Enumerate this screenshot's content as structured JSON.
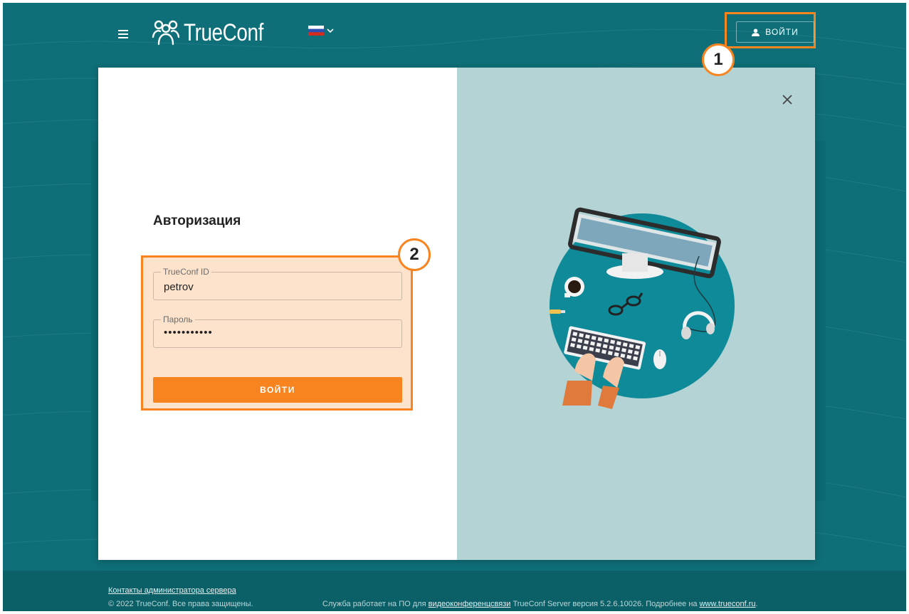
{
  "header": {
    "logo_text": "TrueConf",
    "login_label": "ВОЙТИ"
  },
  "callouts": {
    "one": "1",
    "two": "2"
  },
  "login_form": {
    "title": "Авторизация",
    "id_label": "TrueConf ID",
    "id_value": "petrov",
    "password_label": "Пароль",
    "password_value": "•••••••••••",
    "submit_label": "ВОЙТИ"
  },
  "footer": {
    "contacts_link": "Контакты администратора сервера",
    "copyright": "© 2022 TrueConf. Все права защищены.",
    "service_prefix": "Служба работает на ПО для ",
    "service_link": "видеоконференцсвязи",
    "service_middle": " TrueConf Server версия 5.2.6.10026. Подробнее на ",
    "site_link": "www.trueconf.ru",
    "service_suffix": "."
  },
  "colors": {
    "background": "#0e6f78",
    "accent": "#f7841f",
    "highlight_fill": "#fde3cc",
    "modal_right": "#b3d3d4",
    "footer": "#0b5f67"
  },
  "icons": {
    "menu": "hamburger-menu-icon",
    "logo": "trueconf-people-logo",
    "flag": "russian-flag-icon",
    "user": "user-icon",
    "close": "close-icon"
  }
}
